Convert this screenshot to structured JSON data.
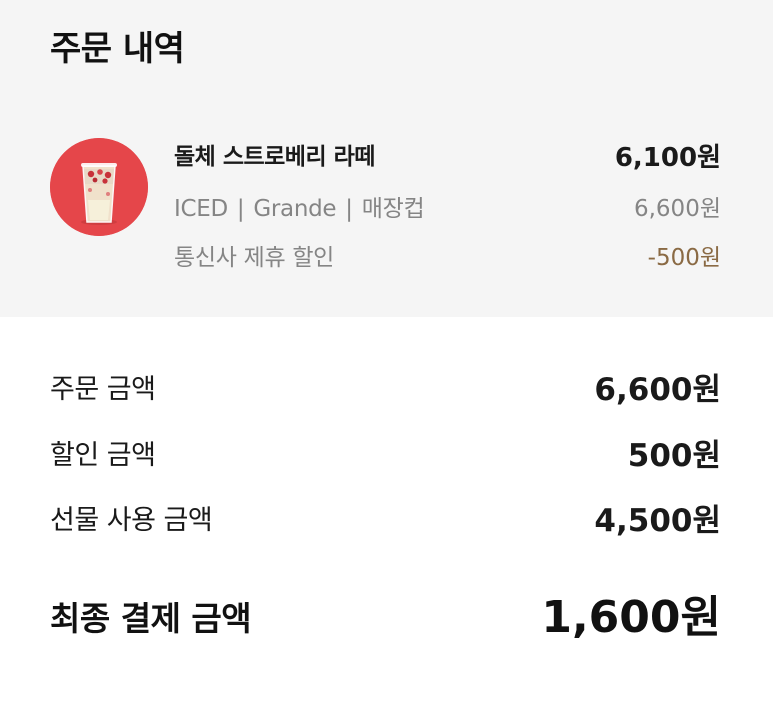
{
  "order_details": {
    "title": "주문 내역",
    "item": {
      "image_icon": "strawberry-latte-icon",
      "name": "돌체 스트로베리 라떼",
      "price": "6,100원",
      "option_temperature": "ICED",
      "option_size": "Grande",
      "option_cup": "매장컵",
      "option_separator": "|",
      "original_price": "6,600원",
      "discount_label": "통신사 제휴 할인",
      "discount_value": "-500원",
      "discount_color": "#8a6a44",
      "thumbnail_color": "#e5464a"
    }
  },
  "summary": {
    "order_amount_label": "주문 금액",
    "order_amount_value": "6,600원",
    "discount_amount_label": "할인 금액",
    "discount_amount_value": "500원",
    "gift_amount_label": "선물 사용 금액",
    "gift_amount_value": "4,500원",
    "final_amount_label": "최종 결제 금액",
    "final_amount_value": "1,600원"
  }
}
